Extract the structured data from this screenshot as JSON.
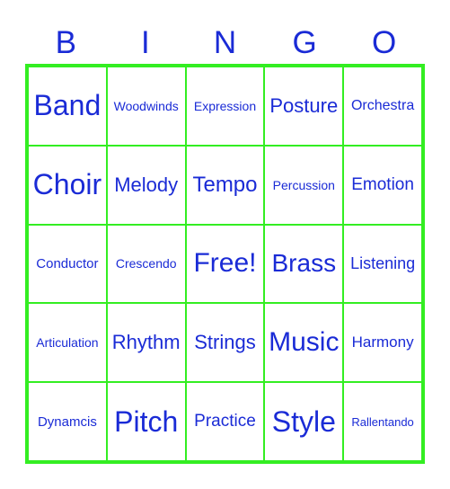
{
  "header": [
    "B",
    "I",
    "N",
    "G",
    "O"
  ],
  "cells": [
    "Band",
    "Woodwinds",
    "Expression",
    "Posture",
    "Orchestra",
    "Choir",
    "Melody",
    "Tempo",
    "Percussion",
    "Emotion",
    "Conductor",
    "Crescendo",
    "Free!",
    "Brass",
    "Listening",
    "Articulation",
    "Rhythm",
    "Strings",
    "Music",
    "Harmony",
    "Dynamcis",
    "Pitch",
    "Practice",
    "Style",
    "Rallentando"
  ],
  "colors": {
    "text": "#1a2bd6",
    "grid": "#33ee22"
  }
}
